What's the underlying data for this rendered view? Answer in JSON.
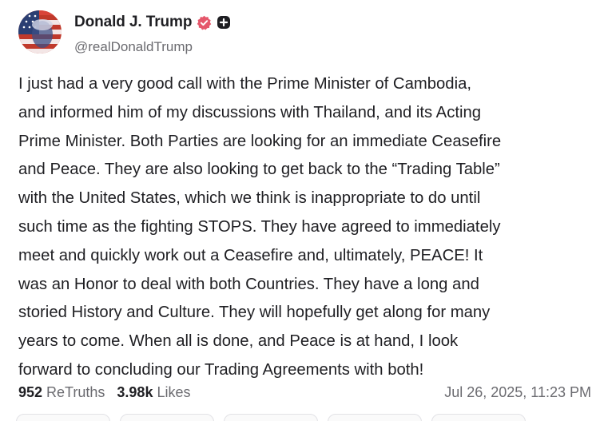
{
  "author": {
    "display_name": "Donald J. Trump",
    "handle": "@realDonaldTrump",
    "verified_icon": "verified-badge-icon",
    "badge_icon": "plus-badge-icon",
    "verified_color": "#e5576b"
  },
  "post": {
    "lines": [
      "I just had a very good call with the Prime Minister of Cambodia,",
      "and informed him of my discussions with Thailand, and its Acting",
      "Prime Minister. Both Parties are looking for an immediate Ceasefire",
      "and Peace. They are also looking to get back to the “Trading Table”",
      "with the United States, which we think is inappropriate to do until",
      "such time as the fighting STOPS. They have agreed to immediately",
      "meet and quickly work out a Ceasefire and, ultimately, PEACE! It",
      "was an Honor to deal with both Countries. They have a long and",
      "storied History and Culture. They will hopefully get along for many",
      "years to come. When all is done, and Peace is at hand, I look",
      "forward to concluding our Trading Agreements with both!"
    ]
  },
  "stats": {
    "retruths_count": "952",
    "retruths_label": "ReTruths",
    "likes_count": "3.98k",
    "likes_label": "Likes"
  },
  "timestamp": "Jul 26, 2025, 11:23 PM"
}
